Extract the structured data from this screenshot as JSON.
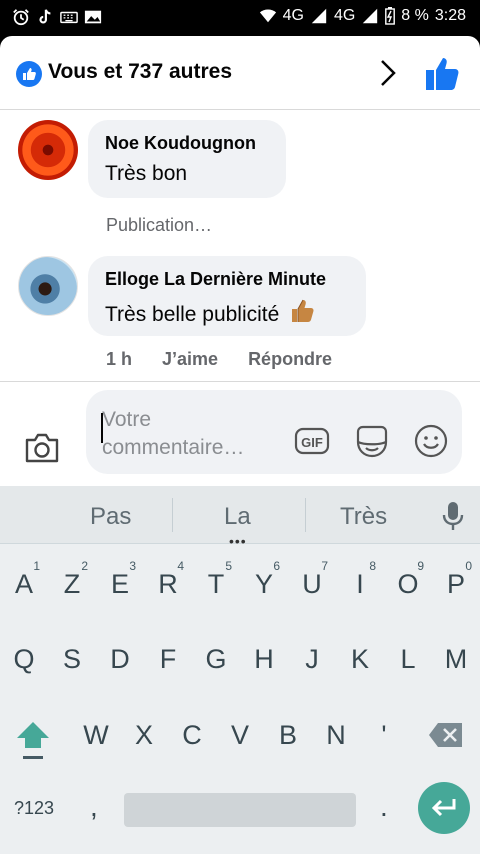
{
  "status_bar": {
    "network_1": "4G",
    "network_2": "4G",
    "battery_percent": "8 %",
    "time": "3:28"
  },
  "header": {
    "title": "Vous et 737 autres"
  },
  "comments": [
    {
      "author": "Noe Koudougnon",
      "text": "Très bon"
    },
    {
      "author": "Elloge La Dernière Minute",
      "text": "Très belle publicité"
    }
  ],
  "pending_label": "Publication…",
  "comment_actions": {
    "time": "1 h",
    "like": "J’aime",
    "reply": "Répondre"
  },
  "composer": {
    "placeholder": "Votre commentaire…"
  },
  "keyboard": {
    "suggestions": [
      "Pas",
      "La",
      "Très"
    ],
    "row1": [
      {
        "k": "A",
        "n": "1"
      },
      {
        "k": "Z",
        "n": "2"
      },
      {
        "k": "E",
        "n": "3"
      },
      {
        "k": "R",
        "n": "4"
      },
      {
        "k": "T",
        "n": "5"
      },
      {
        "k": "Y",
        "n": "6"
      },
      {
        "k": "U",
        "n": "7"
      },
      {
        "k": "I",
        "n": "8"
      },
      {
        "k": "O",
        "n": "9"
      },
      {
        "k": "P",
        "n": "0"
      }
    ],
    "row2": [
      "Q",
      "S",
      "D",
      "F",
      "G",
      "H",
      "J",
      "K",
      "L",
      "M"
    ],
    "row3": [
      "W",
      "X",
      "C",
      "V",
      "B",
      "N",
      "'"
    ],
    "symbols_label": "?123",
    "comma": ",",
    "period": "."
  },
  "colors": {
    "facebook_blue": "#1877f2",
    "bubble_bg": "#f0f2f5",
    "keyboard_accent": "#46a898"
  }
}
